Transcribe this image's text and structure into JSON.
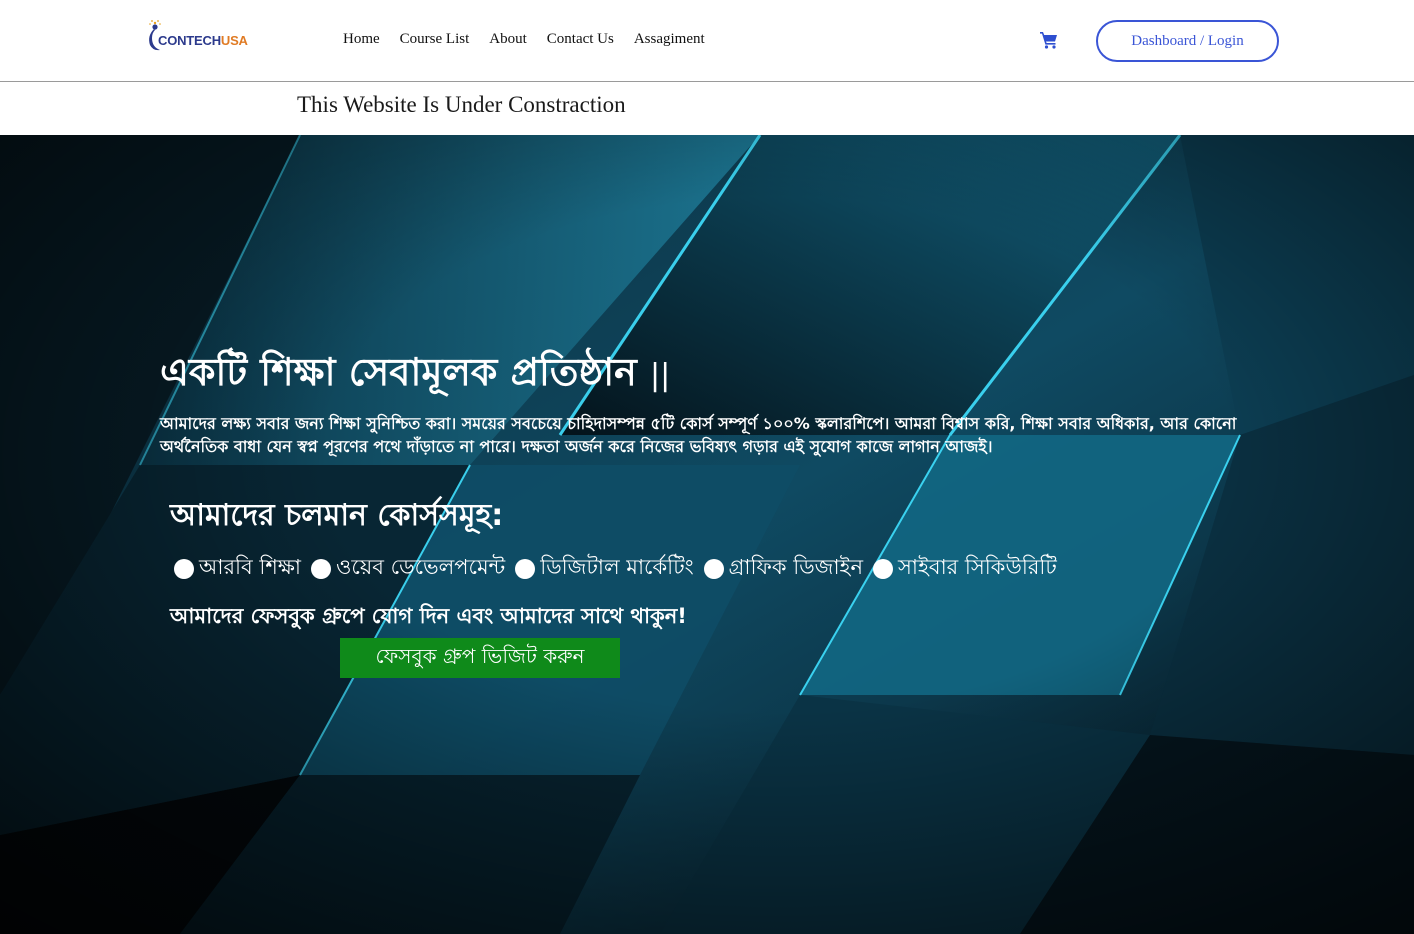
{
  "header": {
    "logo": {
      "part1": "CONTECH",
      "part2": "USA"
    },
    "nav": [
      {
        "label": "Home"
      },
      {
        "label": "Course List"
      },
      {
        "label": "About"
      },
      {
        "label": "Contact Us"
      },
      {
        "label": "Assagiment"
      }
    ],
    "cart_icon": "cart-icon",
    "login_label": "Dashboard / Login"
  },
  "notice": "This Website Is Under Constraction",
  "hero": {
    "title": "একটি শিক্ষা সেবামূলক প্রতিষ্ঠান",
    "title_suffix": "||",
    "description": "আমাদের লক্ষ্য সবার জন্য শিক্ষা সুনিশ্চিত করা। সময়ের সবচেয়ে চাহিদাসম্পন্ন ৫টি কোর্স সম্পূর্ণ ১০০% স্কলারশিপে। আমরা বিশ্বাস করি, শিক্ষা সবার অধিকার, আর কোনো অর্থনৈতিক বাধা যেন স্বপ্ন পূরণের পথে দাঁড়াতে না পারে। দক্ষতা অর্জন করে নিজের ভবিষ্যৎ গড়ার এই সুযোগ কাজে লাগান আজই।",
    "courses_title": "আমাদের চলমান কোর্সসমূহ:",
    "courses": [
      {
        "label": "আরবি শিক্ষা"
      },
      {
        "label": "ওয়েব ডেভেলপমেন্ট"
      },
      {
        "label": "ডিজিটাল মার্কেটিং"
      },
      {
        "label": "গ্রাফিক ডিজাইন"
      },
      {
        "label": "সাইবার সিকিউরিটি"
      }
    ],
    "facebook_text": "আমাদের ফেসবুক গ্রুপে যোগ দিন এবং আমাদের সাথে থাকুন!",
    "facebook_button": "ফেসবুক গ্রুপ ভিজিট করুন"
  },
  "colors": {
    "accent": "#3a55d6",
    "button_green": "#0f8a1a",
    "logo_blue": "#2c3a8c",
    "logo_orange": "#e07b24"
  }
}
